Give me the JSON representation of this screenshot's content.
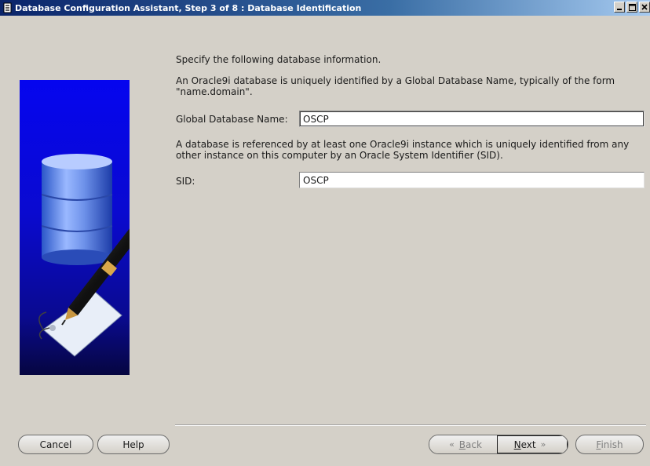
{
  "window": {
    "title": "Database Configuration Assistant, Step 3 of 8 : Database Identification"
  },
  "content": {
    "intro": "Specify the following database information.",
    "global_name_desc_line1": "An Oracle9i database is uniquely identified by a Global Database Name, typically of the form",
    "global_name_desc_line2": "\"name.domain\".",
    "global_name_label": "Global Database Name:",
    "global_name_value": "OSCP",
    "sid_desc_line1": "A database is referenced by at least one Oracle9i instance which is uniquely identified from any",
    "sid_desc_line2": "other instance on this computer by an Oracle System Identifier (SID).",
    "sid_label": "SID:",
    "sid_value": "OSCP"
  },
  "buttons": {
    "cancel": "Cancel",
    "help": "Help",
    "back_prefix": "",
    "back_mnemonic": "B",
    "back_rest": "ack",
    "next_mnemonic": "N",
    "next_rest": "ext",
    "finish_mnemonic": "F",
    "finish_rest": "inish"
  },
  "icons": {
    "title_icon": "database-app-icon",
    "minimize": "minimize-icon",
    "maximize": "maximize-icon",
    "close": "close-icon",
    "back_arrow": "double-chevron-left-icon",
    "next_arrow": "double-chevron-right-icon"
  },
  "colors": {
    "titlebar_start": "#0a246a",
    "titlebar_end": "#a6caf0",
    "background": "#d4d0c8",
    "side_image_blue": "#0505ef"
  }
}
